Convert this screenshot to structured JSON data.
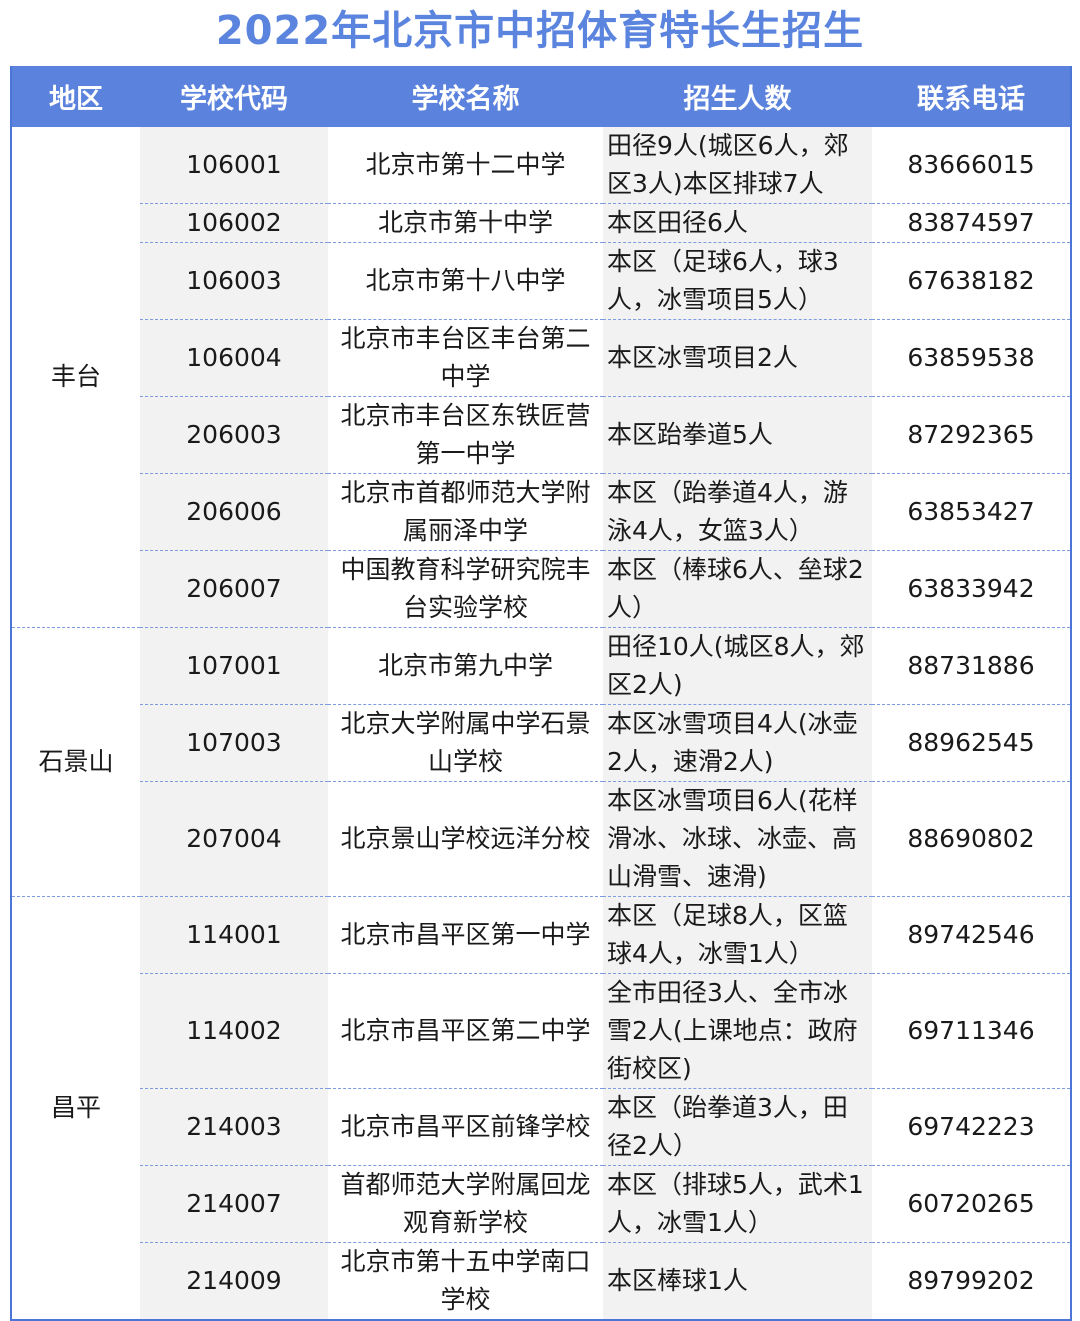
{
  "title": "2022年北京市中招体育特长生招生",
  "headers": [
    "地区",
    "学校代码",
    "学校名称",
    "招生人数",
    "联系电话"
  ],
  "groups": [
    {
      "region": "丰台",
      "rows": [
        {
          "code": "106001",
          "name": "北京市第十二中学",
          "quota": "田径9人(城区6人，郊区3人)本区排球7人",
          "phone": "83666015",
          "h": 76
        },
        {
          "code": "106002",
          "name": "北京市第十中学",
          "quota": "本区田径6人",
          "phone": "83874597",
          "h": 38
        },
        {
          "code": "106003",
          "name": "北京市第十八中学",
          "quota": "本区（足球6人，球3人，冰雪项目5人）",
          "phone": "67638182",
          "h": 76
        },
        {
          "code": "106004",
          "name": "北京市丰台区丰台第二中学",
          "quota": "本区冰雪项目2人",
          "phone": "63859538",
          "h": 76
        },
        {
          "code": "206003",
          "name": "北京市丰台区东铁匠营第一中学",
          "quota": "本区跆拳道5人",
          "phone": "87292365",
          "h": 76
        },
        {
          "code": "206006",
          "name": "北京市首都师范大学附属丽泽中学",
          "quota": "本区（跆拳道4人，游泳4人，女篮3人）",
          "phone": "63853427",
          "h": 76
        },
        {
          "code": "206007",
          "name": "中国教育科学研究院丰台实验学校",
          "quota": "本区（棒球6人、垒球2人）",
          "phone": "63833942",
          "h": 76
        }
      ]
    },
    {
      "region": "石景山",
      "rows": [
        {
          "code": "107001",
          "name": "北京市第九中学",
          "quota": "田径10人(城区8人，郊区2人)",
          "phone": "88731886",
          "h": 76
        },
        {
          "code": "107003",
          "name": "北京大学附属中学石景山学校",
          "quota": "本区冰雪项目4人(冰壶2人，速滑2人)",
          "phone": "88962545",
          "h": 76
        },
        {
          "code": "207004",
          "name": "北京景山学校远洋分校",
          "quota": "本区冰雪项目6人(花样滑冰、冰球、冰壶、高山滑雪、速滑)",
          "phone": "88690802",
          "h": 114
        }
      ]
    },
    {
      "region": "昌平",
      "rows": [
        {
          "code": "114001",
          "name": "北京市昌平区第一中学",
          "quota": "本区（足球8人，区篮球4人，冰雪1人）",
          "phone": "89742546",
          "h": 76
        },
        {
          "code": "114002",
          "name": "北京市昌平区第二中学",
          "quota": "全市田径3人、全市冰雪2人(上课地点：政府街校区)",
          "phone": "69711346",
          "h": 114
        },
        {
          "code": "214003",
          "name": "北京市昌平区前锋学校",
          "quota": "本区（跆拳道3人，田径2人）",
          "phone": "69742223",
          "h": 76
        },
        {
          "code": "214007",
          "name": "首都师范大学附属回龙观育新学校",
          "quota": "本区（排球5人，武术1人，冰雪1人）",
          "phone": "60720265",
          "h": 76
        },
        {
          "code": "214009",
          "name": "北京市第十五中学南口学校",
          "quota": "本区棒球1人",
          "phone": "89799202",
          "h": 76
        }
      ]
    }
  ]
}
